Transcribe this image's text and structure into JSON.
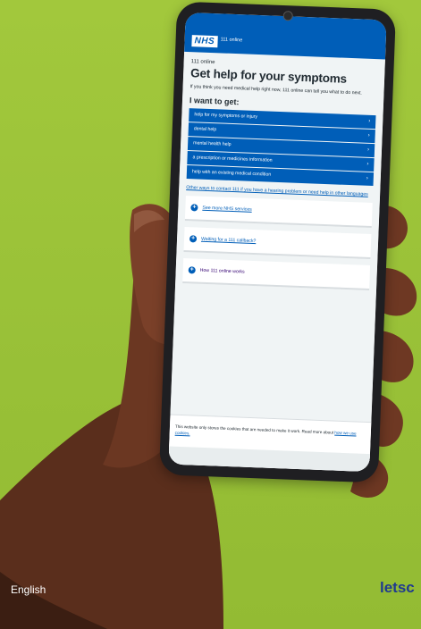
{
  "phone": {
    "header": {
      "logo": "NHS",
      "service": "111 online"
    },
    "crumb": "111 online",
    "title": "Get help for your symptoms",
    "intro": "If you think you need medical help right now, 111 online can tell you what to do next.",
    "subtitle": "I want to get:",
    "options": [
      "help for my symptoms or injury",
      "dental help",
      "mental health help",
      "a prescription or medicines information",
      "help with an existing medical condition"
    ],
    "chevron": "›",
    "contact_link": "Other ways to contact 111 if you have a hearing problem or need help in other languages",
    "cards": [
      {
        "label": "See more NHS services"
      },
      {
        "label": "Waiting for a 111 callback?"
      },
      {
        "label": "How 111 online works"
      }
    ],
    "cookie": {
      "text": "This website only stores the cookies that are needed to make it work. Read more about",
      "link": "how we use cookies."
    }
  },
  "footer": {
    "language": "English",
    "brand": "letsc"
  },
  "colors": {
    "nhs_blue": "#005eb8",
    "background": "#9dc33b",
    "brand": "#1f3a8f"
  },
  "icons": {
    "card_icon": "plus-circle-icon",
    "option_icon": "chevron-right-icon"
  }
}
